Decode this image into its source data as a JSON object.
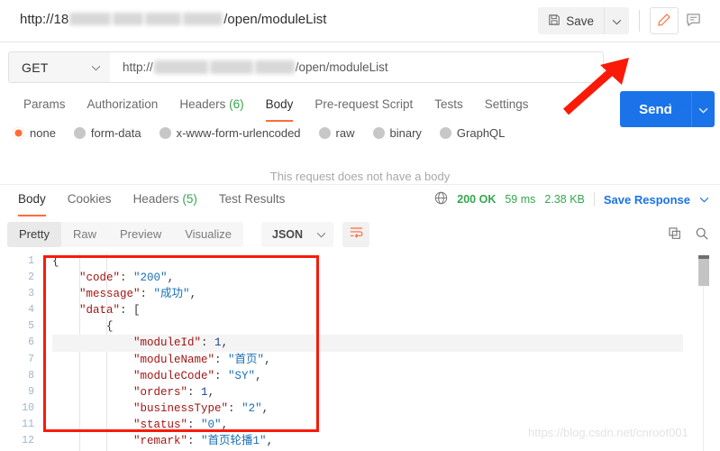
{
  "titlebar": {
    "url_prefix": "http://18",
    "url_suffix": "/open/moduleList",
    "save_label": "Save",
    "icons": {
      "floppy": "save-icon",
      "caret": "chevron-down-icon",
      "pencil": "edit-pencil-icon",
      "comment": "comment-icon"
    }
  },
  "request": {
    "method": "GET",
    "url_prefix": "http://",
    "url_suffix": "/open/moduleList",
    "send_label": "Send"
  },
  "request_tabs": {
    "items": [
      {
        "label": "Params",
        "count": "",
        "active": false
      },
      {
        "label": "Authorization",
        "count": "",
        "active": false
      },
      {
        "label": "Headers",
        "count": "(6)",
        "active": false
      },
      {
        "label": "Body",
        "count": "",
        "active": true
      },
      {
        "label": "Pre-request Script",
        "count": "",
        "active": false
      },
      {
        "label": "Tests",
        "count": "",
        "active": false
      },
      {
        "label": "Settings",
        "count": "",
        "active": false
      }
    ],
    "cookies_link": "Cookies"
  },
  "body_types": {
    "selected": "none",
    "options": [
      {
        "label": "none",
        "selected": true
      },
      {
        "label": "form-data",
        "selected": false
      },
      {
        "label": "x-www-form-urlencoded",
        "selected": false
      },
      {
        "label": "raw",
        "selected": false
      },
      {
        "label": "binary",
        "selected": false
      },
      {
        "label": "GraphQL",
        "selected": false
      }
    ],
    "empty_message": "This request does not have a body"
  },
  "response_tabs": {
    "items": [
      {
        "label": "Body",
        "count": "",
        "active": true
      },
      {
        "label": "Cookies",
        "count": "",
        "active": false
      },
      {
        "label": "Headers",
        "count": "(5)",
        "active": false
      },
      {
        "label": "Test Results",
        "count": "",
        "active": false
      }
    ]
  },
  "response_status": {
    "globe_icon": "globe-icon",
    "status": "200 OK",
    "time": "59 ms",
    "size": "2.38 KB",
    "save_response": "Save Response"
  },
  "format_bar": {
    "views": [
      {
        "label": "Pretty",
        "active": true
      },
      {
        "label": "Raw",
        "active": false
      },
      {
        "label": "Preview",
        "active": false
      },
      {
        "label": "Visualize",
        "active": false
      }
    ],
    "language": "JSON",
    "wrap_icon": "word-wrap-icon",
    "copy_icon": "copy-icon",
    "search_icon": "search-icon"
  },
  "code": {
    "line_numbers": [
      "1",
      "2",
      "3",
      "4",
      "5",
      "6",
      "7",
      "8",
      "9",
      "10",
      "11",
      "12"
    ],
    "lines": [
      {
        "indent": 0,
        "html": "{",
        "highlight": false
      },
      {
        "indent": 1,
        "html": "\"code\": \"200\",",
        "highlight": false
      },
      {
        "indent": 1,
        "html": "\"message\": \"成功\",",
        "highlight": false
      },
      {
        "indent": 1,
        "html": "\"data\": [",
        "highlight": false
      },
      {
        "indent": 2,
        "html": "{",
        "highlight": false
      },
      {
        "indent": 3,
        "html": "\"moduleId\": 1,",
        "highlight": true
      },
      {
        "indent": 3,
        "html": "\"moduleName\": \"首页\",",
        "highlight": false
      },
      {
        "indent": 3,
        "html": "\"moduleCode\": \"SY\",",
        "highlight": false
      },
      {
        "indent": 3,
        "html": "\"orders\": 1,",
        "highlight": false
      },
      {
        "indent": 3,
        "html": "\"businessType\": \"2\",",
        "highlight": false
      },
      {
        "indent": 3,
        "html": "\"status\": \"0\",",
        "highlight": false
      },
      {
        "indent": 3,
        "html": "\"remark\": \"首页轮播1\",",
        "highlight": false
      }
    ],
    "json": {
      "code": "200",
      "message": "成功",
      "data": [
        {
          "moduleId": 1,
          "moduleName": "首页",
          "moduleCode": "SY",
          "orders": 1,
          "businessType": "2",
          "status": "0",
          "remark": "首页轮播1"
        }
      ]
    }
  },
  "annotations": {
    "highlight_box_color": "#fa1a08",
    "arrow_color": "#fa1a08",
    "arrow_target": "send-button",
    "watermark": "https://blog.csdn.net/cnroot001"
  },
  "colors": {
    "accent_orange": "#ff6c37",
    "primary_blue": "#1a73e8",
    "success_green": "#36a64f"
  }
}
